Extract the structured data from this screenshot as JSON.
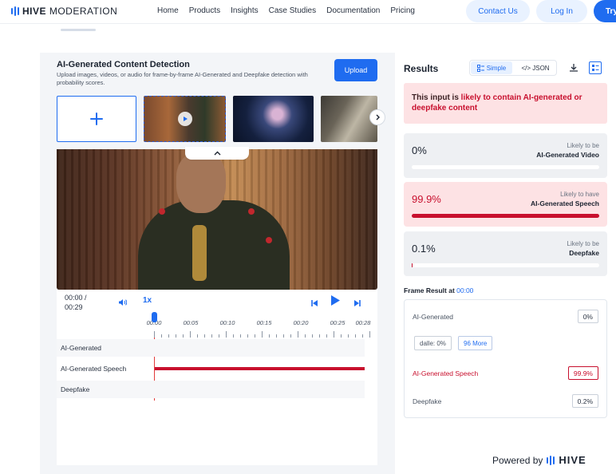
{
  "nav": {
    "brand_bold": "HIVE",
    "brand_light": " MODERATION",
    "links": [
      "Home",
      "Products",
      "Insights",
      "Case Studies",
      "Documentation",
      "Pricing"
    ],
    "contact": "Contact Us",
    "login": "Log In",
    "try": "Try"
  },
  "panel": {
    "title": "AI-Generated Content Detection",
    "description": "Upload images, videos, or audio for frame-by-frame AI-Generated and Deepfake detection with probability scores.",
    "upload": "Upload"
  },
  "player": {
    "time_current": "00:00 /",
    "time_total": "00:29",
    "speed": "1x",
    "ticks": [
      "00:00",
      "00:05",
      "00:10",
      "00:15",
      "00:20",
      "00:25",
      "00:28"
    ],
    "tracks": [
      "AI-Generated",
      "AI-Generated Speech",
      "Deepfake"
    ]
  },
  "results": {
    "title": "Results",
    "simple": "Simple",
    "json": "</> JSON",
    "verdict_pre": "This input is ",
    "verdict_hl": "likely to contain AI-generated or deepfake content",
    "cards": [
      {
        "value": "0%",
        "sub": "Likely to be",
        "name": "AI-Generated Video",
        "fraction": 0.0
      },
      {
        "value": "99.9%",
        "sub": "Likely to have",
        "name": "AI-Generated Speech",
        "fraction": 0.999
      },
      {
        "value": "0.1%",
        "sub": "Likely to be",
        "name": "Deepfake",
        "fraction": 0.001
      }
    ]
  },
  "frame": {
    "title": "Frame Result at ",
    "timestamp": "00:00",
    "rows": [
      {
        "label": "AI-Generated",
        "value": "0%"
      },
      {
        "label": "AI-Generated Speech",
        "value": "99.9%"
      },
      {
        "label": "Deepfake",
        "value": "0.2%"
      }
    ],
    "chip_dalle": "dalle: 0%",
    "chip_more": "96 More"
  },
  "footer": {
    "powered_by": "Powered by",
    "brand": "HIVE"
  },
  "colors": {
    "accent": "#1f6cf0",
    "alert": "#c8102e",
    "alert_bg": "#fde2e4"
  }
}
